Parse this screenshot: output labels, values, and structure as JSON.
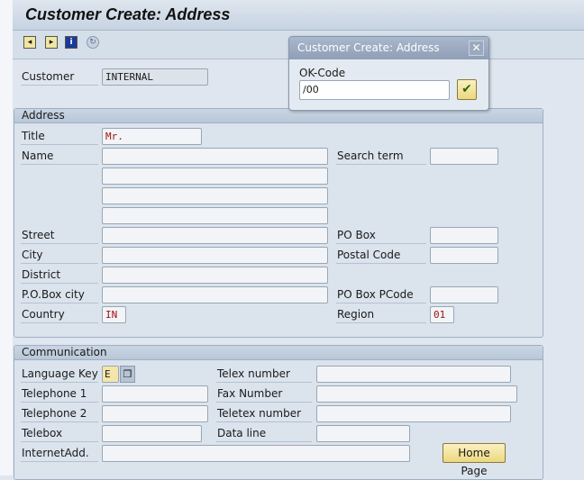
{
  "header": {
    "title": "Customer Create: Address"
  },
  "toolbar": {
    "icons": [
      "previous-screen-icon",
      "next-screen-icon",
      "info-icon",
      "refresh-icon"
    ]
  },
  "customer": {
    "label": "Customer",
    "value": "INTERNAL"
  },
  "address": {
    "group_title": "Address",
    "title": {
      "label": "Title",
      "value": "Mr."
    },
    "name": {
      "label": "Name",
      "values": [
        "",
        "",
        "",
        ""
      ]
    },
    "search_term": {
      "label": "Search term",
      "value": ""
    },
    "street": {
      "label": "Street",
      "value": ""
    },
    "city": {
      "label": "City",
      "value": ""
    },
    "district": {
      "label": "District",
      "value": ""
    },
    "po_box_city": {
      "label": "P.O.Box city",
      "value": ""
    },
    "country": {
      "label": "Country",
      "value": "IN"
    },
    "po_box": {
      "label": "PO Box",
      "value": ""
    },
    "postal_code": {
      "label": "Postal Code",
      "value": ""
    },
    "po_box_pcode": {
      "label": "PO Box PCode",
      "value": ""
    },
    "region": {
      "label": "Region",
      "value": "01"
    }
  },
  "communication": {
    "group_title": "Communication",
    "language_key": {
      "label": "Language Key",
      "value": "E"
    },
    "telephone1": {
      "label": "Telephone 1",
      "value": ""
    },
    "telephone2": {
      "label": "Telephone 2",
      "value": ""
    },
    "telebox": {
      "label": "Telebox",
      "value": ""
    },
    "internet": {
      "label": "InternetAdd.",
      "value": ""
    },
    "telex": {
      "label": "Telex number",
      "value": ""
    },
    "fax": {
      "label": "Fax Number",
      "value": ""
    },
    "teletex": {
      "label": "Teletex number",
      "value": ""
    },
    "data_line": {
      "label": "Data line",
      "value": ""
    },
    "home_page_button": "Home Page"
  },
  "dialog": {
    "title": "Customer Create: Address",
    "close": "✕",
    "ok_code_label": "OK-Code",
    "ok_code_value": "/00",
    "confirm": "✔"
  }
}
